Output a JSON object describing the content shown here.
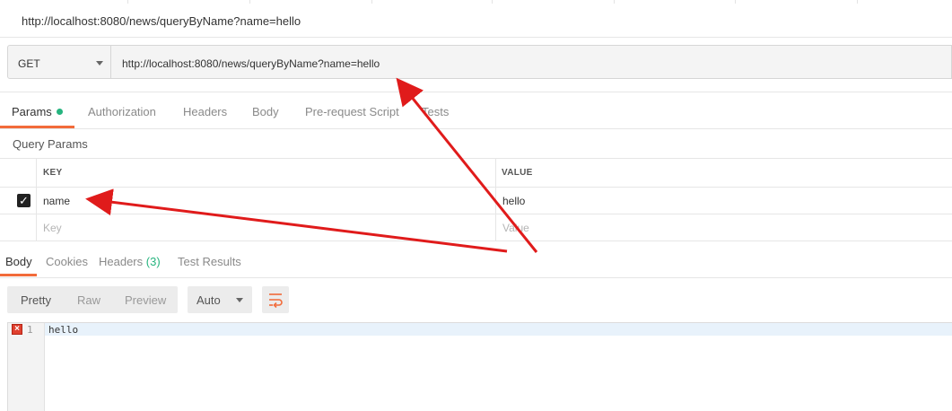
{
  "title": "http://localhost:8080/news/queryByName?name=hello",
  "request": {
    "method": "GET",
    "url": "http://localhost:8080/news/queryByName?name=hello"
  },
  "request_tabs": [
    {
      "label": "Params",
      "active": true,
      "has_dot": true
    },
    {
      "label": "Authorization"
    },
    {
      "label": "Headers"
    },
    {
      "label": "Body"
    },
    {
      "label": "Pre-request Script"
    },
    {
      "label": "Tests"
    }
  ],
  "query_params": {
    "section_label": "Query Params",
    "columns": [
      "KEY",
      "VALUE"
    ],
    "rows": [
      {
        "checked": true,
        "key": "name",
        "value": "hello"
      }
    ],
    "placeholder_row": {
      "key": "Key",
      "value": "Value"
    }
  },
  "response_tabs": [
    {
      "label": "Body",
      "active": true
    },
    {
      "label": "Cookies"
    },
    {
      "label": "Headers",
      "count": "(3)"
    },
    {
      "label": "Test Results"
    }
  ],
  "response_toolbar": {
    "views": [
      "Pretty",
      "Raw",
      "Preview"
    ],
    "format": "Auto"
  },
  "response_body": {
    "lines": [
      {
        "number": "1",
        "text": "hello"
      }
    ]
  },
  "colors": {
    "accent": "#f26b3a",
    "dot_green": "#26b47f",
    "annotation_arrow": "#e01b1b"
  }
}
